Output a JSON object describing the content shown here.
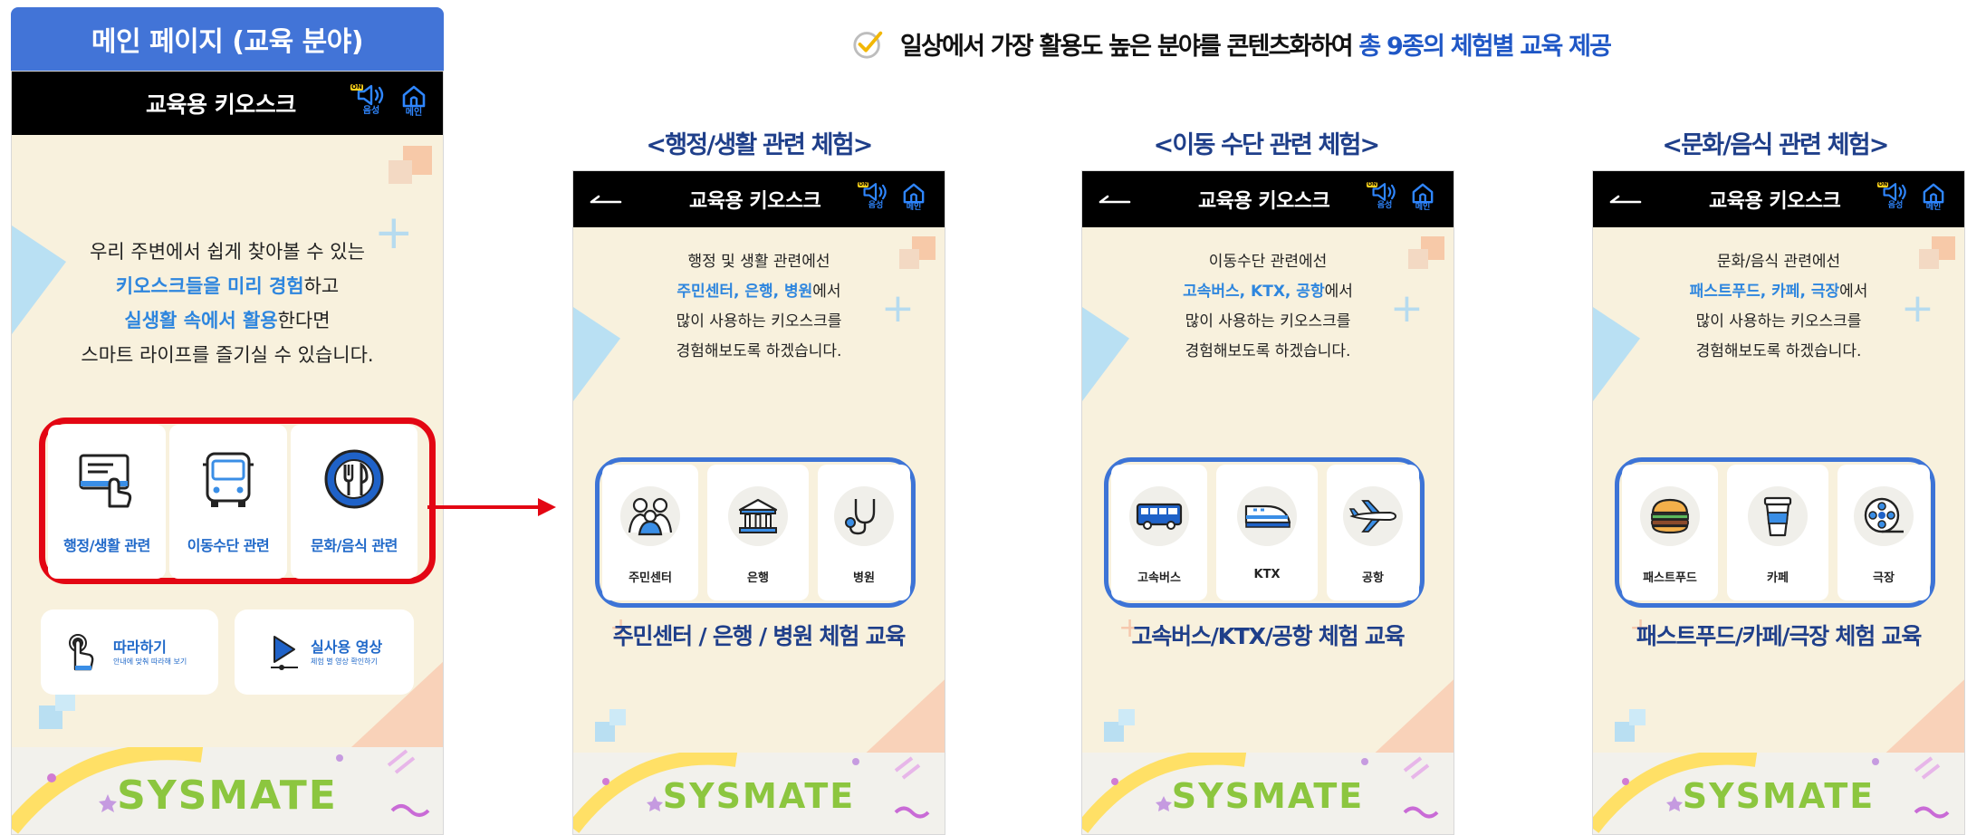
{
  "headline": {
    "text": "일상에서 가장 활용도 높은 분야를 콘텐츠화하여 ",
    "accent": "총 9종의 체험별 교육 제공",
    "icon": "check-circle-icon"
  },
  "main": {
    "header": "메인 페이지 (교육 분야)",
    "kiosk_title": "교육용 키오스크",
    "voice_label": "음성",
    "voice_on": "ON",
    "home_label": "메인",
    "intro": {
      "line1": "우리 주변에서 쉽게 찾아볼 수 있는",
      "line2_accent": "키오스크들을 미리 경험",
      "line2_rest": "하고",
      "line3_accent": "실생활 속에서 활용",
      "line3_rest": "한다면",
      "line4": "스마트 라이프를 즐기실 수 있습니다."
    },
    "categories": [
      {
        "label": "행정/생활 관련",
        "icon": "document-hand-icon"
      },
      {
        "label": "이동수단 관련",
        "icon": "bus-icon"
      },
      {
        "label": "문화/음식 관련",
        "icon": "dining-icon"
      }
    ],
    "follow": {
      "title": "따라하기",
      "sub": "안내에 맞춰 따라해 보기"
    },
    "video": {
      "title": "실사용 영상",
      "sub": "체험 별 영상 확인하기"
    },
    "brand": "SYSMATE",
    "colors": {
      "accent": "#2e86de",
      "highlight": "#e30613",
      "frame": "#3d74d6"
    }
  },
  "panels": [
    {
      "title": "<행정/생활 관련 체험>",
      "kiosk_title": "교육용 키오스크",
      "intro_line1": "행정 및 생활 관련에선",
      "intro_accent": "주민센터, 은행, 병원",
      "intro_rest": "에서",
      "intro_line3": "많이 사용하는 키오스크를",
      "intro_line4": "경험해보도록 하겠습니다.",
      "items": [
        {
          "label": "주민센터",
          "icon": "people-icon"
        },
        {
          "label": "은행",
          "icon": "bank-icon"
        },
        {
          "label": "병원",
          "icon": "stethoscope-icon"
        }
      ],
      "caption": "주민센터 / 은행 / 병원 체험 교육"
    },
    {
      "title": "<이동 수단 관련 체험>",
      "kiosk_title": "교육용 키오스크",
      "intro_line1": "이동수단 관련에선",
      "intro_accent": "고속버스, KTX, 공항",
      "intro_rest": "에서",
      "intro_line3": "많이 사용하는 키오스크를",
      "intro_line4": "경험해보도록 하겠습니다.",
      "items": [
        {
          "label": "고속버스",
          "icon": "express-bus-icon"
        },
        {
          "label": "KTX",
          "icon": "train-icon"
        },
        {
          "label": "공항",
          "icon": "airplane-icon"
        }
      ],
      "caption": "고속버스/KTX/공항 체험 교육"
    },
    {
      "title": "<문화/음식 관련 체험>",
      "kiosk_title": "교육용 키오스크",
      "intro_line1": "문화/음식 관련에선",
      "intro_accent": "패스트푸드, 카페, 극장",
      "intro_rest": "에서",
      "intro_line3": "많이 사용하는 키오스크를",
      "intro_line4": "경험해보도록 하겠습니다.",
      "items": [
        {
          "label": "패스트푸드",
          "icon": "burger-icon"
        },
        {
          "label": "카페",
          "icon": "coffee-cup-icon"
        },
        {
          "label": "극장",
          "icon": "film-reel-icon"
        }
      ],
      "caption": "패스트푸드/카페/극장 체험 교육"
    }
  ]
}
